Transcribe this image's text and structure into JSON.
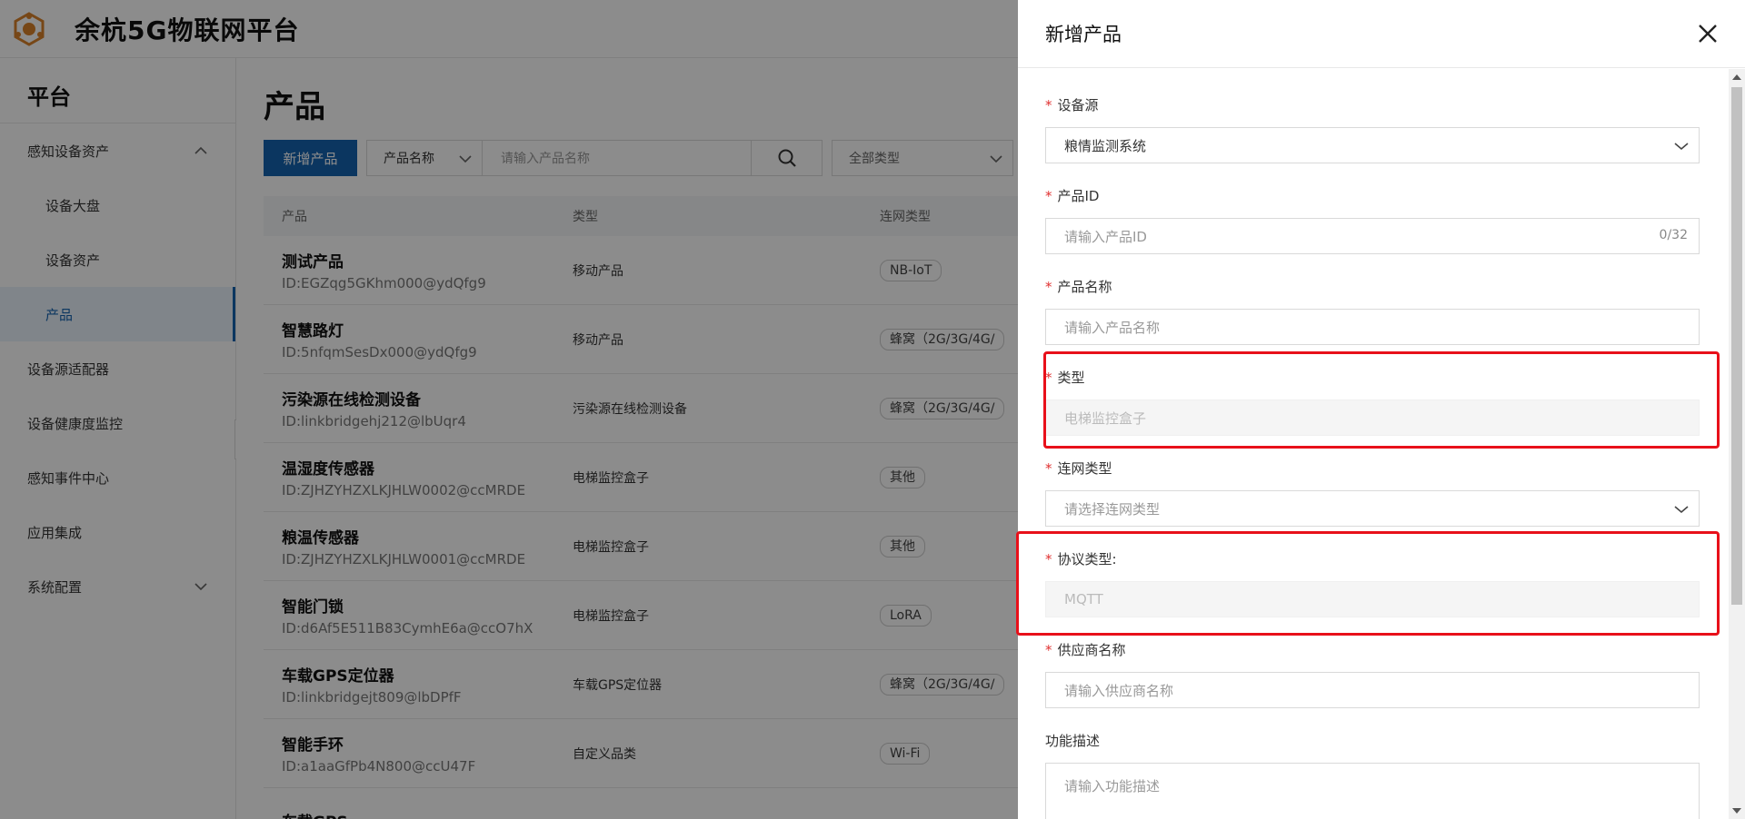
{
  "header": {
    "title": "余杭5G物联网平台"
  },
  "sidebar": {
    "title": "平台",
    "items": [
      {
        "label": "感知设备资产",
        "expanded": true
      },
      {
        "label": "设备大盘"
      },
      {
        "label": "设备资产"
      },
      {
        "label": "产品",
        "active": true
      },
      {
        "label": "设备源适配器"
      },
      {
        "label": "设备健康度监控"
      },
      {
        "label": "感知事件中心"
      },
      {
        "label": "应用集成"
      },
      {
        "label": "系统配置",
        "expanded": false
      }
    ]
  },
  "main": {
    "title": "产品",
    "toolbar": {
      "add_label": "新增产品",
      "field_select": "产品名称",
      "search_placeholder": "请输入产品名称",
      "type_select": "全部类型"
    },
    "table": {
      "headers": [
        "产品",
        "类型",
        "连网类型"
      ],
      "rows": [
        {
          "name": "测试产品",
          "id": "ID:EGZqg5GKhm000@ydQfg9",
          "type": "移动产品",
          "net": "NB-IoT"
        },
        {
          "name": "智慧路灯",
          "id": "ID:5nfqmSesDx000@ydQfg9",
          "type": "移动产品",
          "net": "蜂窝（2G/3G/4G/"
        },
        {
          "name": "污染源在线检测设备",
          "id": "ID:linkbridgehj212@lbUqr4",
          "type": "污染源在线检测设备",
          "net": "蜂窝（2G/3G/4G/"
        },
        {
          "name": "温湿度传感器",
          "id": "ID:ZJHZYHZXLKJHLW0002@ccMRDE",
          "type": "电梯监控盒子",
          "net": "其他"
        },
        {
          "name": "粮温传感器",
          "id": "ID:ZJHZYHZXLKJHLW0001@ccMRDE",
          "type": "电梯监控盒子",
          "net": "其他"
        },
        {
          "name": "智能门锁",
          "id": "ID:d6Af5E511B83CymhE6a@ccO7hX",
          "type": "电梯监控盒子",
          "net": "LoRA"
        },
        {
          "name": "车载GPS定位器",
          "id": "ID:linkbridgejt809@lbDPfF",
          "type": "车载GPS定位器",
          "net": "蜂窝（2G/3G/4G/"
        },
        {
          "name": "智能手环",
          "id": "ID:a1aaGfPb4N800@ccU47F",
          "type": "自定义品类",
          "net": "Wi-Fi"
        },
        {
          "name": "车载GPS",
          "id": "",
          "type": "",
          "net": ""
        }
      ]
    }
  },
  "drawer": {
    "title": "新增产品",
    "fields": {
      "source": {
        "label": "设备源",
        "value": "粮情监测系统"
      },
      "product_id": {
        "label": "产品ID",
        "placeholder": "请输入产品ID",
        "counter": "0/32"
      },
      "product_name": {
        "label": "产品名称",
        "placeholder": "请输入产品名称"
      },
      "type": {
        "label": "类型",
        "value": "电梯监控盒子"
      },
      "net_type": {
        "label": "连网类型",
        "placeholder": "请选择连网类型"
      },
      "protocol": {
        "label": "协议类型:",
        "value": "MQTT"
      },
      "vendor": {
        "label": "供应商名称",
        "placeholder": "请输入供应商名称"
      },
      "description": {
        "label": "功能描述",
        "placeholder": "请输入功能描述"
      }
    },
    "required_mark": "*"
  },
  "colors": {
    "primary": "#1463b0",
    "highlight": "#e8101a",
    "required": "#e03030"
  }
}
